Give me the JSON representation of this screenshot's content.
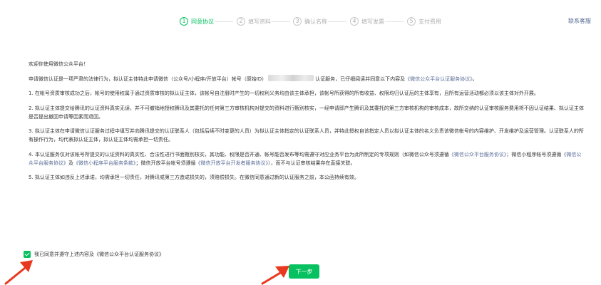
{
  "steps": [
    {
      "num": "1",
      "label": "同意协议",
      "active": true
    },
    {
      "num": "2",
      "label": "填写资料"
    },
    {
      "num": "3",
      "label": "确认名称"
    },
    {
      "num": "4",
      "label": "填写发票"
    },
    {
      "num": "5",
      "label": "支付费用"
    }
  ],
  "header": {
    "service_link": "联系客服"
  },
  "agreement": {
    "greeting": "欢迎你使用微信公众平台！",
    "intro_pre": "申请微信认证是一项严肃的法律行为，拟认证主体特此申请微信（公众号/小程序/开放平台）帐号（原始ID）",
    "intro_mid": "认证服务，已仔细阅读并同意以下内容及",
    "intro_link": "《微信公众平台认证服务协议》",
    "intro_end": "。",
    "p1": "1. 在帐号资质审核成功之后，帐号的使用权属于通过资质审核的拟认证主体，该帐号自注册时产生的一切权利义务均由该主体承担，该帐号所获得的所有收益、权限均归认证后的主体享有，且所有运营活动都必须以该主体对外开展。",
    "p2": "2. 拟认证主体提交给腾讯的认证资料真实无误，并不可撤销地授权腾讯及其委托的任何第三方审核机构对提交的资料进行甄别核实，一经申请即产生腾讯及其委托的第三方审核机构的审核成本，故所交纳的认证审核服务费用将不因认证结果、拟认证主体是否提出撤回申请等因素而退回。",
    "p3": "3. 拟认证主体在申请微信认证服务过程中填写并向腾讯提交的认证联系人（包括后续不时变更的人员）为拟认证主体指定的认证联系人员，并特此授权自该指定人员以拟认证主体的名义负责该微信帐号的内容维护、开发维护及运营管理。认证联系人的所有操作行为，均代表拟认证主体，拟认证主体均需承担一切责任。",
    "p4_a": "4. 本认证服务仅对该帐号所提交的认证资料的真实性、合法性进行书面甄别核实，其功能、权限是否开通、帐号能否发布等均需遵守对应业务平台为此所制定的专项规则（如微信公众号须遵循",
    "p4_link1": "《微信公众平台服务协议》",
    "p4_b": "；微信小程序帐号须遵循",
    "p4_link2": "《微信公众平台服务协议》",
    "p4_c": "及",
    "p4_link3": "《微信小程序平台服务条款》",
    "p4_d": "；微信开放平台帐号须遵循",
    "p4_link4": "《微信开放平台开发者服务协议》",
    "p4_e": "），而不与认证审核结果存在直接关联。",
    "p5": "5. 拟认证主体如违反上述承诺，均需承担一切责任，对腾讯或第三方造成损失的，须赔偿损失。在微信同意通过新的认证服务之前，本公函持续有效。"
  },
  "consent": {
    "text": "我已同意并遵守上述内容及《微信公众平台认证服务协议》",
    "checked": true
  },
  "next_button": {
    "label": "下一步"
  },
  "colors": {
    "accent": "#07c160",
    "link": "#576b95",
    "arrow": "#e8391f"
  }
}
